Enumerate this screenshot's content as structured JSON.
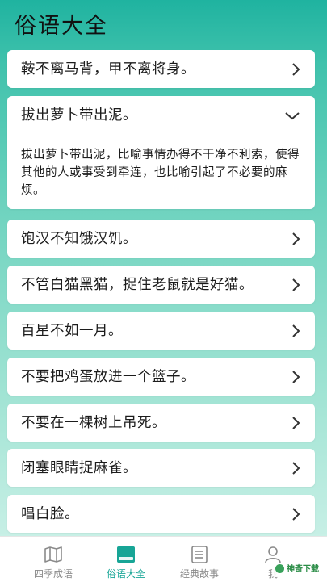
{
  "header": {
    "title": "俗语大全"
  },
  "proverbs": [
    {
      "title": "鞍不离马背，甲不离将身。",
      "expanded": false
    },
    {
      "title": "拔出萝卜带出泥。",
      "expanded": true,
      "explanation": "拔出萝卜带出泥，比喻事情办得不干净不利索，使得其他的人或事受到牵连，也比喻引起了不必要的麻烦。"
    },
    {
      "title": "饱汉不知饿汉饥。",
      "expanded": false
    },
    {
      "title": "不管白猫黑猫，捉住老鼠就是好猫。",
      "expanded": false
    },
    {
      "title": "百星不如一月。",
      "expanded": false
    },
    {
      "title": "不要把鸡蛋放进一个篮子。",
      "expanded": false
    },
    {
      "title": "不要在一棵树上吊死。",
      "expanded": false
    },
    {
      "title": "闭塞眼睛捉麻雀。",
      "expanded": false
    },
    {
      "title": "唱白脸。",
      "expanded": false
    }
  ],
  "tabbar": {
    "items": [
      {
        "label": "四季成语",
        "icon": "book-map-icon",
        "active": false
      },
      {
        "label": "俗语大全",
        "icon": "book-icon",
        "active": true
      },
      {
        "label": "经典故事",
        "icon": "document-list-icon",
        "active": false
      },
      {
        "label": "我",
        "icon": "user-icon",
        "active": false
      }
    ]
  },
  "watermark": {
    "text": "神奇下载"
  },
  "colors": {
    "accent": "#17a596",
    "card": "#ffffff",
    "header_bg": "#1fb3a0"
  }
}
